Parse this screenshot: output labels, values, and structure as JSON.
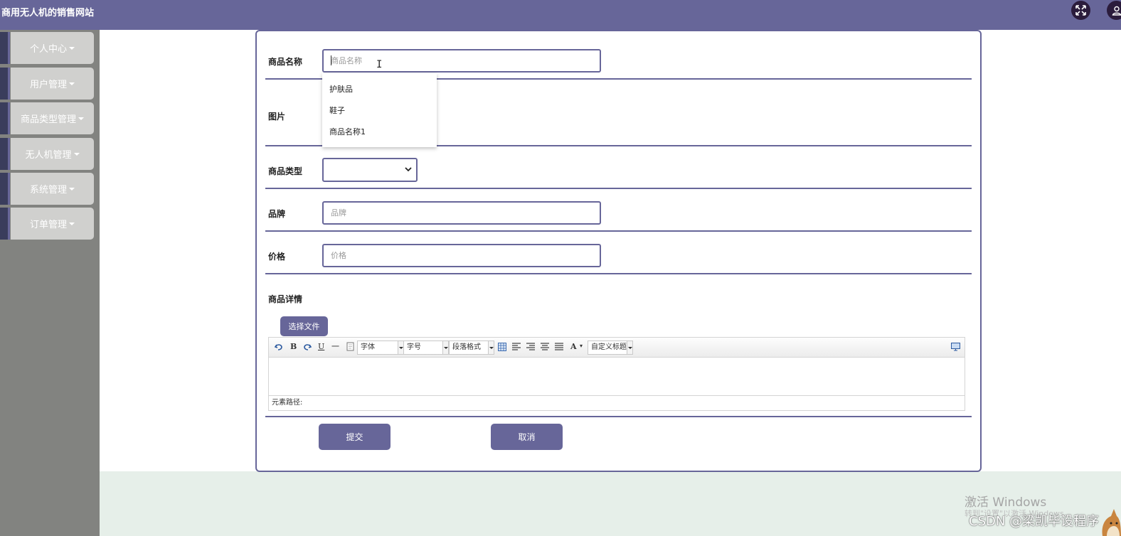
{
  "header": {
    "site_title": "商用无人机的销售网站",
    "bg_color": "#676699"
  },
  "sidebar": {
    "items": [
      {
        "label": "个人中心"
      },
      {
        "label": "用户管理"
      },
      {
        "label": "商品类型管理"
      },
      {
        "label": "无人机管理"
      },
      {
        "label": "系统管理"
      },
      {
        "label": "订单管理"
      }
    ]
  },
  "form": {
    "name": {
      "label": "商品名称",
      "placeholder": "商品名称",
      "value": ""
    },
    "name_suggestions": [
      "护肤品",
      "鞋子",
      "商品名称1"
    ],
    "image": {
      "label": "图片"
    },
    "type": {
      "label": "商品类型",
      "selected": ""
    },
    "brand": {
      "label": "品牌",
      "placeholder": "品牌"
    },
    "price": {
      "label": "价格",
      "placeholder": "价格"
    },
    "detail": {
      "label": "商品详情",
      "file_button": "选择文件"
    },
    "submit_label": "提交",
    "cancel_label": "取消"
  },
  "editor": {
    "icons": [
      "undo-icon",
      "bold-icon",
      "redo-icon",
      "underline-icon",
      "horizontal-rule-icon",
      "paste-plain-icon",
      "table-icon",
      "align-left-icon",
      "align-right-icon",
      "align-center-icon",
      "justify-icon",
      "font-color-icon",
      "preview-icon"
    ],
    "font_family": "字体",
    "font_size": "字号",
    "paragraph": "段落格式",
    "custom_title": "自定义标题",
    "bold_glyph": "B",
    "underline_glyph": "U",
    "hr_glyph": "一",
    "fontcolor_glyph": "A",
    "element_path": "元素路径:"
  },
  "overlay": {
    "windows_title": "激活 Windows",
    "windows_sub": "转到\"设置\"以激活 Windows。",
    "csdn": "CSDN @梁凯毕设程序"
  }
}
